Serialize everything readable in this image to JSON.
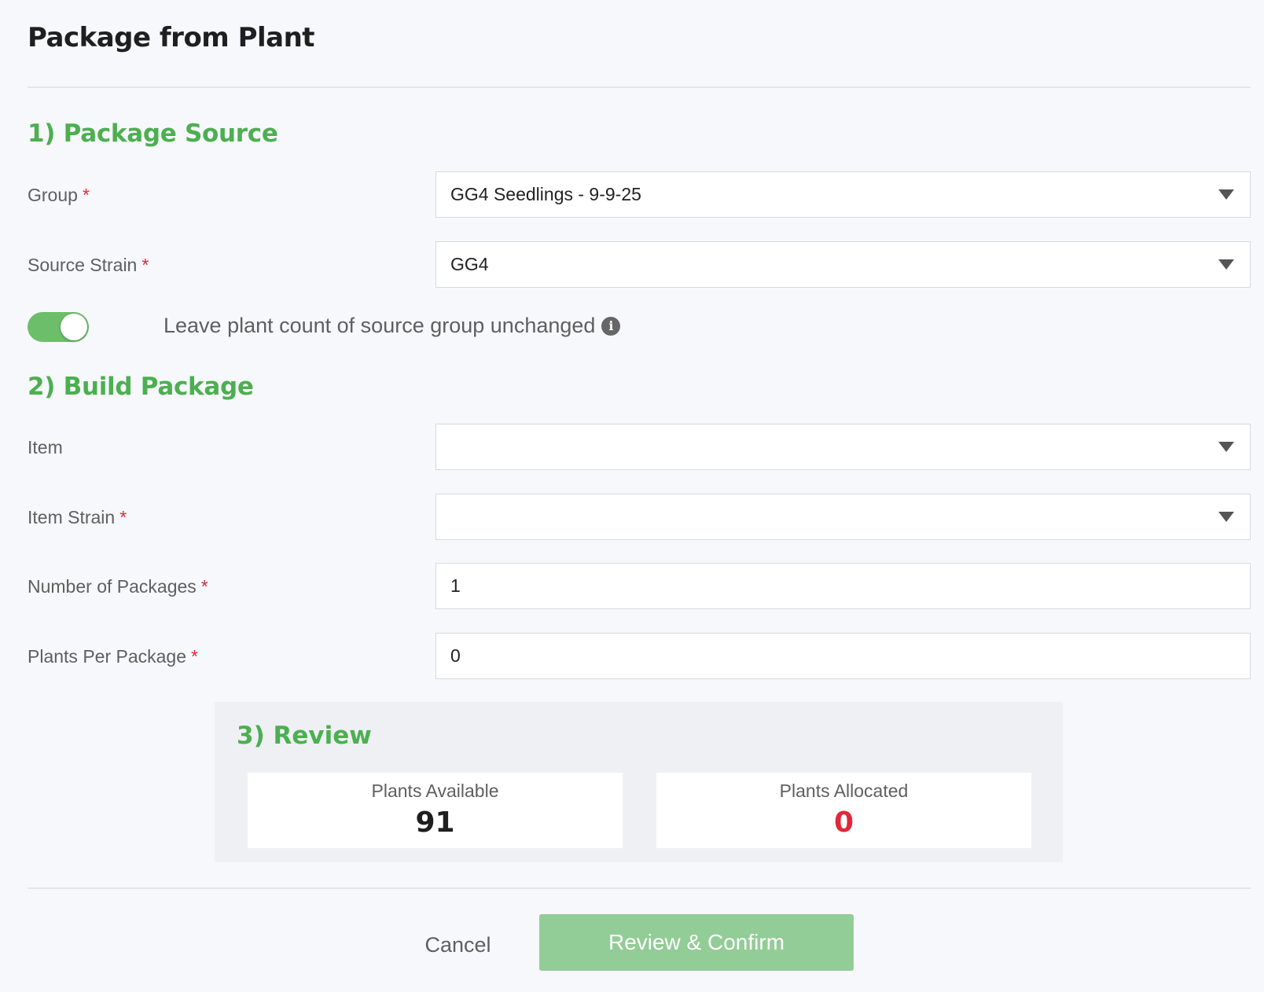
{
  "page": {
    "title": "Package from Plant"
  },
  "colors": {
    "accent": "#4caf50",
    "required": "#e0283a",
    "button_bg": "#92cc96",
    "allocated_value": "#e0283a"
  },
  "section1": {
    "heading": "1) Package Source",
    "group": {
      "label": "Group",
      "required_mark": "*",
      "value": "GG4 Seedlings - 9-9-25"
    },
    "source_strain": {
      "label": "Source Strain",
      "required_mark": "*",
      "value": "GG4"
    },
    "toggle": {
      "label": "Leave plant count of source group unchanged",
      "on": true,
      "info_icon": "info-icon"
    }
  },
  "section2": {
    "heading": "2) Build Package",
    "item": {
      "label": "Item",
      "value": ""
    },
    "item_strain": {
      "label": "Item Strain",
      "required_mark": "*",
      "value": ""
    },
    "number_of_packages": {
      "label": "Number of Packages",
      "required_mark": "*",
      "value": "1"
    },
    "plants_per_package": {
      "label": "Plants Per Package",
      "required_mark": "*",
      "value": "0"
    }
  },
  "section3": {
    "heading": "3) Review",
    "plants_available": {
      "label": "Plants Available",
      "value": "91"
    },
    "plants_allocated": {
      "label": "Plants Allocated",
      "value": "0"
    }
  },
  "footer": {
    "cancel_label": "Cancel",
    "confirm_label": "Review & Confirm"
  }
}
